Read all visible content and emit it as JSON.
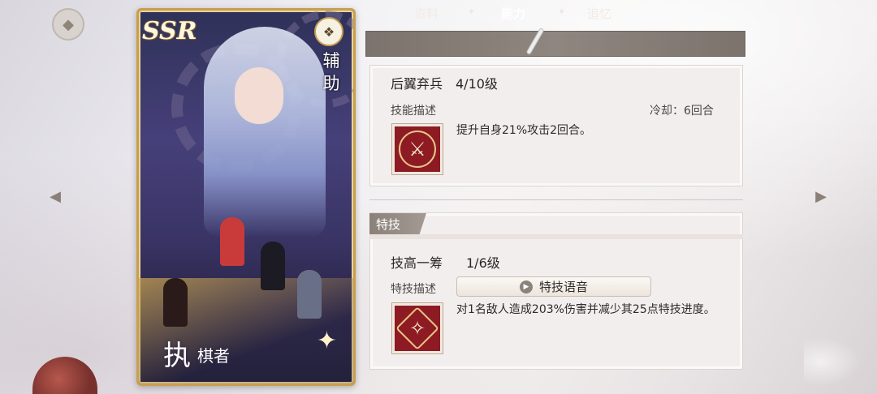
{
  "card": {
    "rarity": "SSR",
    "role_label": "辅助",
    "name_large": "执",
    "name_small": "棋者"
  },
  "tabs": [
    {
      "label": "资料",
      "active": false
    },
    {
      "label": "能力",
      "active": true
    },
    {
      "label": "追忆",
      "active": false
    }
  ],
  "skill": {
    "name": "后翼弃兵",
    "level": "4/10级",
    "desc_label": "技能描述",
    "cooldown": "冷却：6回合",
    "description": "提升自身21%攻击2回合。"
  },
  "special": {
    "section_title": "特技",
    "name": "技高一筹",
    "level": "1/6级",
    "desc_label": "特技描述",
    "voice_button": "特技语音",
    "description": "对1名敌人造成203%伤害并减少其25点特技进度。"
  },
  "colors": {
    "tab_bar": "#8f8680",
    "skill_icon_bg": "#8e1a23",
    "card_border": "#c79f4e"
  },
  "icons": {
    "back": "back-arrow-icon",
    "prev": "left-arrow-icon",
    "next": "right-arrow-icon",
    "skill": "crossed-weapons-icon",
    "special": "gem-crystal-icon",
    "voice": "play-icon"
  }
}
